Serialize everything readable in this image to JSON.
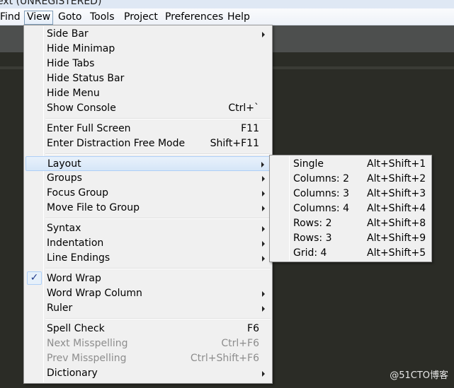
{
  "window": {
    "title": "ext (UNREGISTERED)"
  },
  "menubar": [
    "Find",
    "View",
    "Goto",
    "Tools",
    "Project",
    "Preferences",
    "Help"
  ],
  "view_menu": {
    "items": [
      {
        "label": "Side Bar",
        "shortcut": "",
        "submenu": true
      },
      {
        "label": "Hide Minimap",
        "shortcut": ""
      },
      {
        "label": "Hide Tabs",
        "shortcut": ""
      },
      {
        "label": "Hide Status Bar",
        "shortcut": ""
      },
      {
        "label": "Hide Menu",
        "shortcut": ""
      },
      {
        "label": "Show Console",
        "shortcut": "Ctrl+`"
      },
      {
        "label": "Enter Full Screen",
        "shortcut": "F11"
      },
      {
        "label": "Enter Distraction Free Mode",
        "shortcut": "Shift+F11"
      },
      {
        "label": "Layout",
        "shortcut": "",
        "submenu": true,
        "highlighted": true
      },
      {
        "label": "Groups",
        "shortcut": "",
        "submenu": true
      },
      {
        "label": "Focus Group",
        "shortcut": "",
        "submenu": true
      },
      {
        "label": "Move File to Group",
        "shortcut": "",
        "submenu": true
      },
      {
        "label": "Syntax",
        "shortcut": "",
        "submenu": true
      },
      {
        "label": "Indentation",
        "shortcut": "",
        "submenu": true
      },
      {
        "label": "Line Endings",
        "shortcut": "",
        "submenu": true
      },
      {
        "label": "Word Wrap",
        "shortcut": "",
        "checked": true
      },
      {
        "label": "Word Wrap Column",
        "shortcut": "",
        "submenu": true
      },
      {
        "label": "Ruler",
        "shortcut": "",
        "submenu": true
      },
      {
        "label": "Spell Check",
        "shortcut": "F6"
      },
      {
        "label": "Next Misspelling",
        "shortcut": "Ctrl+F6",
        "disabled": true
      },
      {
        "label": "Prev Misspelling",
        "shortcut": "Ctrl+Shift+F6",
        "disabled": true
      },
      {
        "label": "Dictionary",
        "shortcut": "",
        "submenu": true
      }
    ]
  },
  "layout_submenu": {
    "items": [
      {
        "label": "Single",
        "shortcut": "Alt+Shift+1"
      },
      {
        "label": "Columns: 2",
        "shortcut": "Alt+Shift+2"
      },
      {
        "label": "Columns: 3",
        "shortcut": "Alt+Shift+3"
      },
      {
        "label": "Columns: 4",
        "shortcut": "Alt+Shift+4"
      },
      {
        "label": "Rows: 2",
        "shortcut": "Alt+Shift+8"
      },
      {
        "label": "Rows: 3",
        "shortcut": "Alt+Shift+9"
      },
      {
        "label": "Grid: 4",
        "shortcut": "Alt+Shift+5"
      }
    ]
  },
  "watermark": "@51CTO博客",
  "colors": {
    "highlight": "#d6e6f8",
    "check": "#1f3a8a",
    "editor_bg": "#2b2c26"
  }
}
